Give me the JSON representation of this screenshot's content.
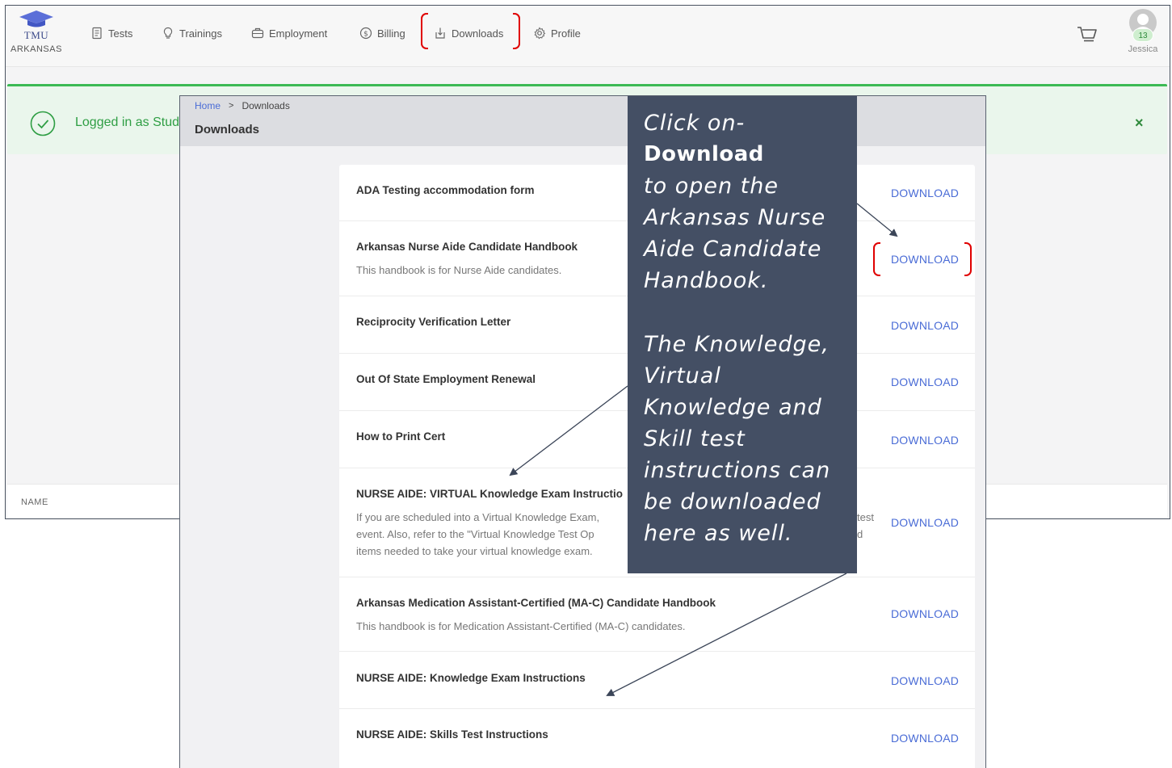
{
  "brand": {
    "name": "TMU",
    "state": "ARKANSAS"
  },
  "nav": {
    "tests": "Tests",
    "trainings": "Trainings",
    "employment": "Employment",
    "billing": "Billing",
    "downloads": "Downloads",
    "profile": "Profile"
  },
  "user": {
    "name": "Jessica",
    "notification_count": "13"
  },
  "alert": {
    "message": "Logged in as Stud",
    "close": "×"
  },
  "table": {
    "column_name": "NAME"
  },
  "modal": {
    "breadcrumb": {
      "home": "Home",
      "separator": ">",
      "current": "Downloads"
    },
    "title": "Downloads"
  },
  "downloads": [
    {
      "title": "ADA Testing accommodation form",
      "description": "",
      "action": "DOWNLOAD"
    },
    {
      "title": "Arkansas Nurse Aide Candidate Handbook",
      "description": "This handbook is for Nurse Aide candidates.",
      "action": "DOWNLOAD"
    },
    {
      "title": "Reciprocity Verification Letter",
      "description": "",
      "action": "DOWNLOAD"
    },
    {
      "title": "Out Of State Employment Renewal",
      "description": "",
      "action": "DOWNLOAD"
    },
    {
      "title": "How to Print Cert",
      "description": "",
      "action": "DOWNLOAD"
    },
    {
      "title": "NURSE AIDE: VIRTUAL Knowledge Exam Instructio",
      "description": "If you are scheduled into a Virtual Knowledge Exam, ... test event. Also, refer to the \"Virtual Knowledge Test Op... d items needed to take your virtual knowledge exam.",
      "desc_lines": [
        "If you are scheduled into a Virtual Knowledge Exam,",
        "event. Also, refer to the \"Virtual Knowledge Test Op",
        "items needed to take your virtual knowledge exam."
      ],
      "desc_right": [
        "test",
        "d"
      ],
      "action": "DOWNLOAD"
    },
    {
      "title": "Arkansas Medication Assistant-Certified (MA-C) Candidate Handbook",
      "description": "This handbook is for Medication Assistant-Certified (MA-C) candidates.",
      "action": "DOWNLOAD"
    },
    {
      "title": "NURSE AIDE: Knowledge Exam Instructions",
      "description": "",
      "action": "DOWNLOAD"
    },
    {
      "title": "NURSE AIDE: Skills Test Instructions",
      "description": "",
      "action": "DOWNLOAD"
    }
  ],
  "callout": {
    "line1": "Click on-",
    "bold": "Download",
    "line2": "to open the Arkansas Nurse Aide Candidate Handbook.",
    "para2": "The Knowledge, Virtual Knowledge and Skill test instructions can be downloaded here as well."
  },
  "colors": {
    "accent_link": "#4a6cd6",
    "success": "#3cba54",
    "callout_bg": "#444f64",
    "highlight_red": "#e00000"
  }
}
